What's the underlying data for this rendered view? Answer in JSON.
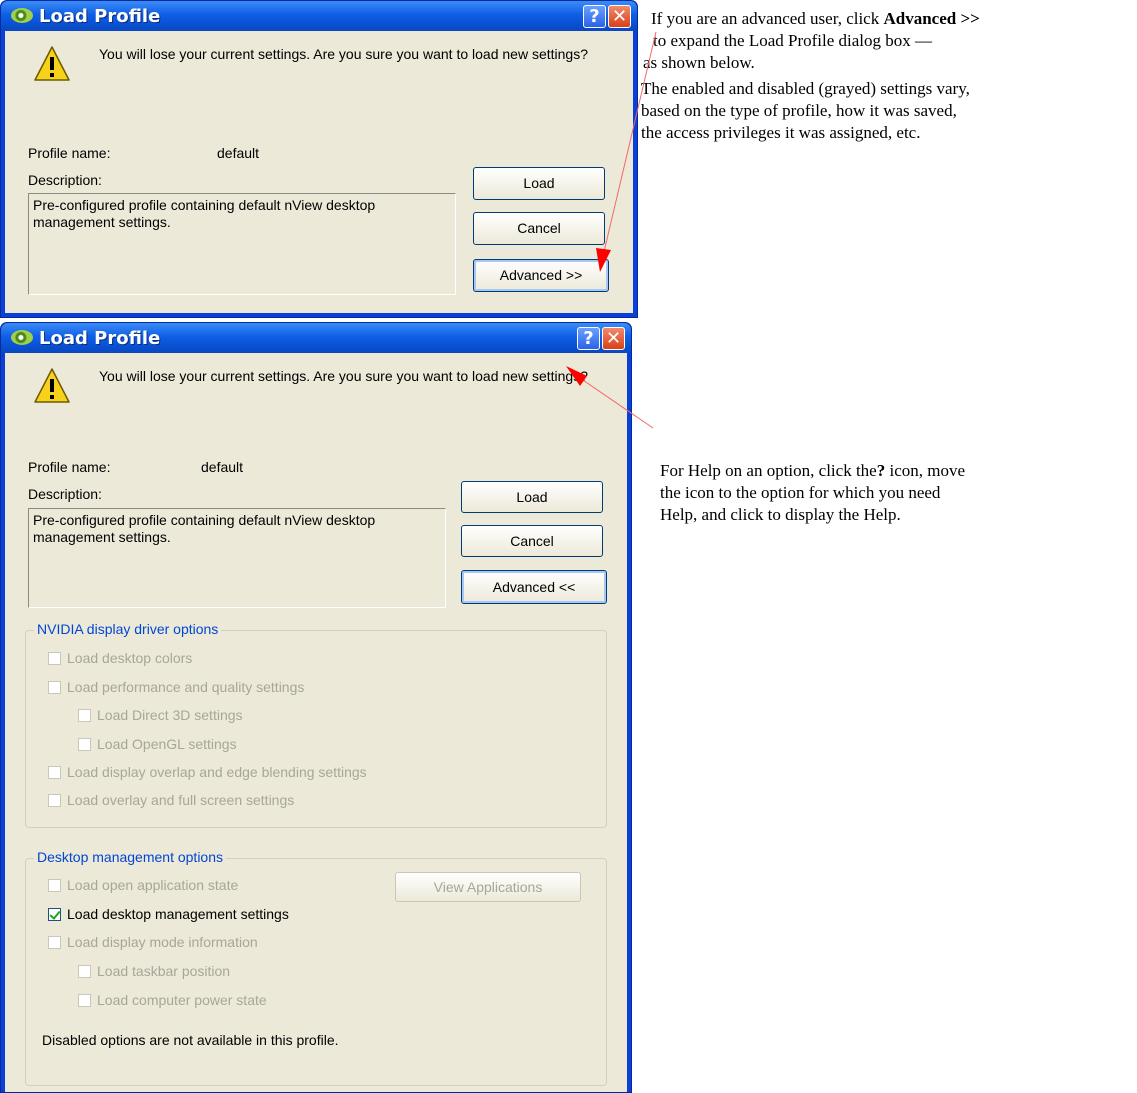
{
  "dialog_collapsed": {
    "title": "Load Profile",
    "help_label": "?",
    "close_label": "✕",
    "message": "You will lose your current settings. Are you sure you want to load new settings?",
    "profile_name_label": "Profile name:",
    "profile_name_value": "default",
    "description_label": "Description:",
    "description_value": "Pre-configured profile containing default nView desktop management settings.",
    "load_button": "Load",
    "cancel_button": "Cancel",
    "advanced_button": "Advanced >>"
  },
  "dialog_expanded": {
    "title": "Load Profile",
    "help_label": "?",
    "close_label": "✕",
    "message": "You will lose your current settings. Are you sure you want to load new settings?",
    "profile_name_label": "Profile name:",
    "profile_name_value": "default",
    "description_label": "Description:",
    "description_value": "Pre-configured profile containing default nView desktop management settings.",
    "load_button": "Load",
    "cancel_button": "Cancel",
    "advanced_button": "Advanced <<",
    "nvidia_group": {
      "title": "NVIDIA display driver options",
      "items": [
        {
          "label": "Load desktop colors",
          "checked": false,
          "enabled": false
        },
        {
          "label": "Load performance and quality settings",
          "checked": false,
          "enabled": false
        },
        {
          "label": "Load Direct 3D settings",
          "checked": false,
          "enabled": false
        },
        {
          "label": "Load OpenGL settings",
          "checked": false,
          "enabled": false
        },
        {
          "label": "Load display overlap and edge blending settings",
          "checked": false,
          "enabled": false
        },
        {
          "label": "Load overlay and full screen settings",
          "checked": false,
          "enabled": false
        }
      ]
    },
    "desktop_group": {
      "title": "Desktop management options",
      "view_applications_button": "View Applications",
      "items": [
        {
          "label": "Load open application state",
          "checked": false,
          "enabled": false
        },
        {
          "label": "Load desktop management settings",
          "checked": true,
          "enabled": true
        },
        {
          "label": "Load display mode information",
          "checked": false,
          "enabled": false
        },
        {
          "label": "Load taskbar position",
          "checked": false,
          "enabled": false
        },
        {
          "label": "Load computer power state",
          "checked": false,
          "enabled": false
        }
      ],
      "footer_note": "Disabled options are not available in this profile."
    }
  },
  "annotations": {
    "advanced_note": {
      "line1_prefix": "If you are an advanced user, click ",
      "line1_bold": "Advanced >>",
      "line2": "to expand the Load Profile dialog box —",
      "line3": "as shown below.",
      "line4": "The enabled and disabled (grayed) settings vary,",
      "line5": "based on the type of profile, how it was saved,",
      "line6": "the access privileges it was assigned, etc."
    },
    "help_note": {
      "line1_prefix": "For Help on an option, click the",
      "line1_bold": "?",
      "line1_suffix": " icon, move",
      "line2": "the icon to the option for which you need",
      "line3": "Help, and click to display the Help."
    },
    "arrow_color": "#ff0000"
  }
}
